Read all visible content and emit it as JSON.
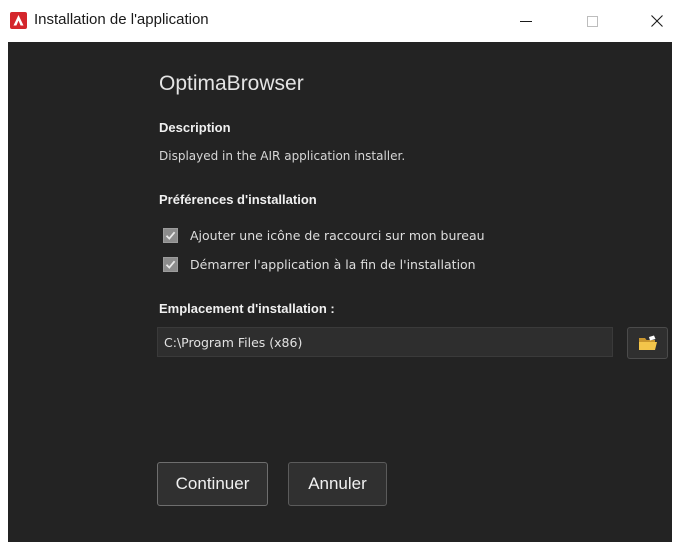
{
  "window": {
    "title": "Installation de l'application",
    "icon": "adobe-air-icon",
    "controls": [
      "minimize-icon",
      "maximize-icon",
      "close-icon"
    ],
    "accent_color": "#d4262c",
    "background_color": "#232323"
  },
  "app": {
    "name": "OptimaBrowser"
  },
  "description": {
    "title": "Description",
    "text": "Displayed in the AIR application installer."
  },
  "preferences": {
    "title": "Préférences d'installation",
    "options": [
      {
        "label": "Ajouter une icône de raccourci sur mon bureau",
        "checked": true
      },
      {
        "label": "Démarrer l'application à la fin de l'installation",
        "checked": true
      }
    ]
  },
  "location": {
    "title": "Emplacement d'installation :",
    "value": "C:\\Program Files (x86)",
    "browse_icon": "folder-icon"
  },
  "buttons": {
    "continue_label": "Continuer",
    "cancel_label": "Annuler"
  }
}
